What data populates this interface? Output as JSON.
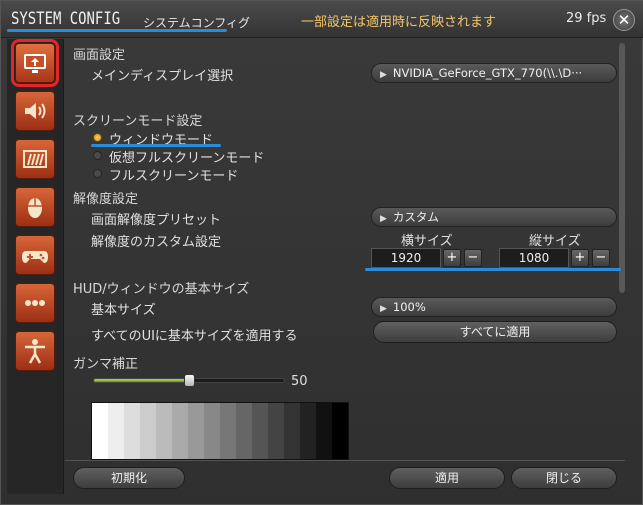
{
  "title": {
    "main": "SYSTEM CONFIG",
    "sub": "システムコンフィグ",
    "notice": "一部設定は適用時に反映されます",
    "fps": "29 fps",
    "close_glyph": "✕"
  },
  "sidebar": {
    "items": [
      {
        "icon": "display-icon",
        "active": true
      },
      {
        "icon": "speaker-icon",
        "active": false
      },
      {
        "icon": "panel-icon",
        "active": false
      },
      {
        "icon": "mouse-icon",
        "active": false
      },
      {
        "icon": "gamepad-icon",
        "active": false
      },
      {
        "icon": "more-icon",
        "active": false
      },
      {
        "icon": "accessibility-icon",
        "active": false
      }
    ]
  },
  "display": {
    "section": "画面設定",
    "main_display_label": "メインディスプレイ選択",
    "main_display_value": "NVIDIA_GeForce_GTX_770(\\\\.\\D···"
  },
  "screen_mode": {
    "section": "スクリーンモード設定",
    "options": [
      "ウィンドウモード",
      "仮想フルスクリーンモード",
      "フルスクリーンモード"
    ],
    "selected": 0
  },
  "resolution": {
    "section": "解像度設定",
    "preset_label": "画面解像度プリセット",
    "preset_value": "カスタム",
    "custom_label": "解像度のカスタム設定",
    "width_label": "横サイズ",
    "height_label": "縦サイズ",
    "width_value": "1920",
    "height_value": "1080",
    "plus": "+",
    "minus": "−"
  },
  "hud": {
    "section": "HUD/ウィンドウの基本サイズ",
    "base_size_label": "基本サイズ",
    "base_size_value": "100%",
    "apply_all_label": "すべてのUIに基本サイズを適用する",
    "apply_all_button": "すべてに適用"
  },
  "gamma": {
    "section": "ガンマ補正",
    "value": "50",
    "level": 0.5
  },
  "footer": {
    "reset": "初期化",
    "apply": "適用",
    "close": "閉じる"
  },
  "colors": {
    "accent": "#2a8cd8",
    "notice": "#f2c66a",
    "tab_bg": "#c4502a",
    "active_outline": "#e4252a"
  }
}
